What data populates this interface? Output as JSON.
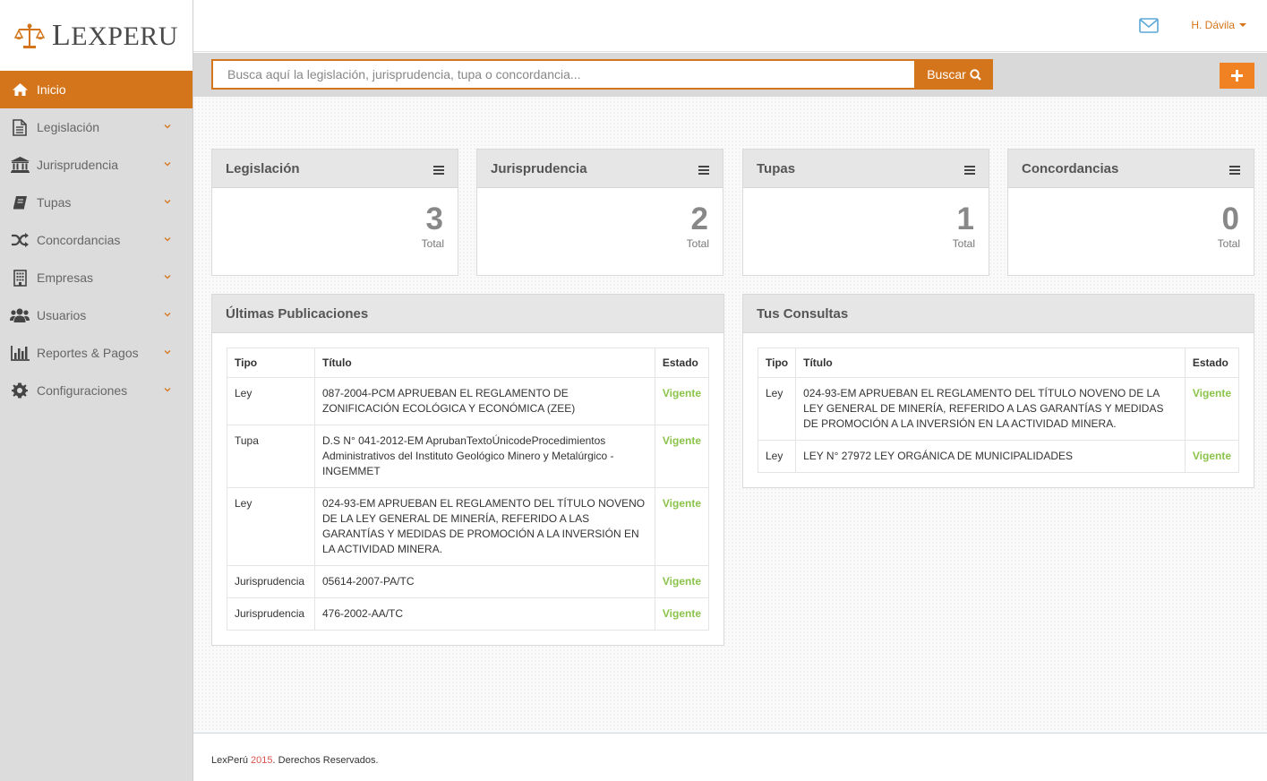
{
  "brand": {
    "logo_text_big": "L",
    "logo_text_rest": "EXPERU",
    "logo_name": "scales-of-justice-logo"
  },
  "colors": {
    "accent": "#d5751b",
    "accent_light": "#f08223",
    "status_green": "#8bc34a",
    "sidebar_bg": "#dcdcdc"
  },
  "header": {
    "user_name": "H. Dávila",
    "mail_icon": "envelope-icon"
  },
  "search": {
    "placeholder": "Busca aquí la legislación, jurisprudencia, tupa o concordancia...",
    "value": "",
    "button_label": "Buscar",
    "add_icon": "plus-icon"
  },
  "sidebar": {
    "items": [
      {
        "label": "Inicio",
        "icon": "home-icon",
        "active": true
      },
      {
        "label": "Legislación",
        "icon": "document-icon"
      },
      {
        "label": "Jurisprudencia",
        "icon": "institution-icon"
      },
      {
        "label": "Tupas",
        "icon": "book-icon"
      },
      {
        "label": "Concordancias",
        "icon": "random-icon"
      },
      {
        "label": "Empresas",
        "icon": "building-icon"
      },
      {
        "label": "Usuarios",
        "icon": "users-icon"
      },
      {
        "label": "Reportes & Pagos",
        "icon": "bar-chart-icon"
      },
      {
        "label": "Configuraciones",
        "icon": "gear-icon"
      }
    ]
  },
  "stats": [
    {
      "title": "Legislación",
      "value": "3",
      "label": "Total"
    },
    {
      "title": "Jurisprudencia",
      "value": "2",
      "label": "Total"
    },
    {
      "title": "Tupas",
      "value": "1",
      "label": "Total"
    },
    {
      "title": "Concordancias",
      "value": "0",
      "label": "Total"
    }
  ],
  "publicaciones": {
    "title": "Últimas Publicaciones",
    "columns": [
      "Tipo",
      "Título",
      "Estado"
    ],
    "rows": [
      {
        "tipo": "Ley",
        "titulo": "087-2004-PCM APRUEBAN EL REGLAMENTO DE ZONIFICACIÓN ECOLÓGICA Y ECONÓMICA (ZEE)",
        "estado": "Vigente"
      },
      {
        "tipo": "Tupa",
        "titulo": "D.S N° 041-2012-EM AprubanTextoÚnicodeProcedimientos Administrativos del Instituto Geológico Minero y Metalúrgico - INGEMMET",
        "estado": "Vigente"
      },
      {
        "tipo": "Ley",
        "titulo": "024-93-EM APRUEBAN EL REGLAMENTO DEL TÍTULO NOVENO DE LA LEY GENERAL DE MINERÍA, REFERIDO A LAS GARANTÍAS Y MEDIDAS DE PROMOCIÓN A LA INVERSIÓN EN LA ACTIVIDAD MINERA.",
        "estado": "Vigente"
      },
      {
        "tipo": "Jurisprudencia",
        "titulo": "05614-2007-PA/TC",
        "estado": "Vigente"
      },
      {
        "tipo": "Jurisprudencia",
        "titulo": "476-2002-AA/TC",
        "estado": "Vigente"
      }
    ]
  },
  "consultas": {
    "title": "Tus Consultas",
    "columns": [
      "Tipo",
      "Título",
      "Estado"
    ],
    "rows": [
      {
        "tipo": "Ley",
        "titulo": "024-93-EM APRUEBAN EL REGLAMENTO DEL TÍTULO NOVENO DE LA LEY GENERAL DE MINERÍA, REFERIDO A LAS GARANTÍAS Y MEDIDAS DE PROMOCIÓN A LA INVERSIÓN EN LA ACTIVIDAD MINERA.",
        "estado": "Vigente"
      },
      {
        "tipo": "Ley",
        "titulo": "LEY N° 27972 LEY ORGÁNICA DE MUNICIPALIDADES",
        "estado": "Vigente"
      }
    ]
  },
  "footer": {
    "brand": "LexPerú",
    "year": "2015",
    "rest": ". Derechos Reservados."
  }
}
